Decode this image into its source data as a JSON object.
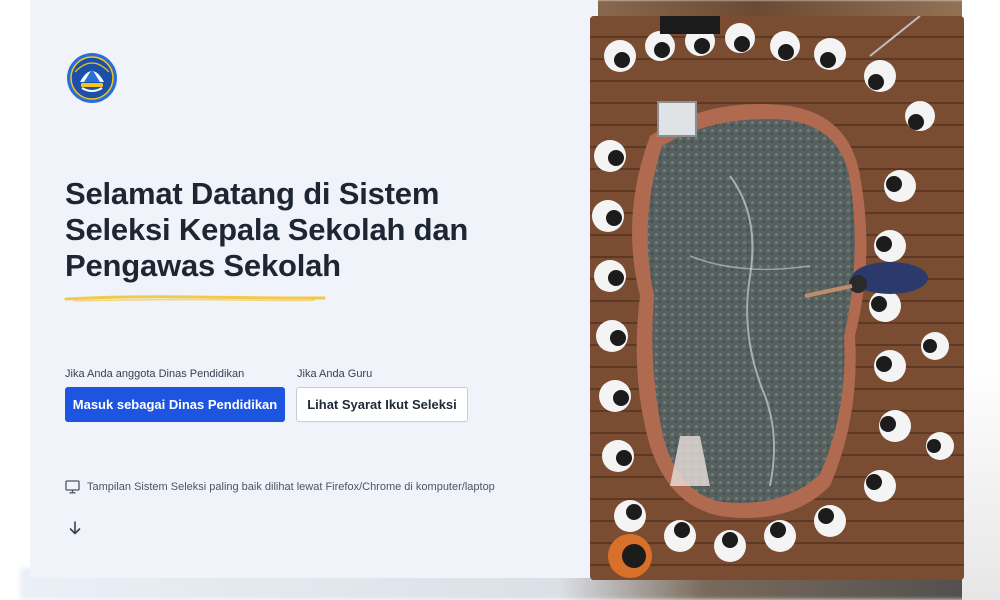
{
  "page": {
    "headline": [
      "Selamat Datang di Sistem",
      "Seleksi Kepala Sekolah dan",
      "Pengawas Sekolah"
    ]
  },
  "cta": {
    "dinas": {
      "label": "Jika Anda anggota Dinas Pendidikan",
      "button": "Masuk sebagai Dinas Pendidikan"
    },
    "guru": {
      "label": "Jika Anda Guru",
      "button": "Lihat Syarat Ikut Seleksi"
    }
  },
  "notice": {
    "icon": "monitor-icon",
    "text": "Tampilan Sistem Seleksi paling baik dilihat lewat Firefox/Chrome di komputer/laptop"
  },
  "scroll": {
    "icon": "arrow-down-icon"
  },
  "logo": {
    "icon": "kemendikbud-logo"
  },
  "hero": {
    "icon": "students-around-map-photo"
  },
  "colors": {
    "primary": "#1e55e0",
    "panel_bg": "#f0f4fa",
    "headline": "#1e2633",
    "underline": "#f2c94c"
  }
}
